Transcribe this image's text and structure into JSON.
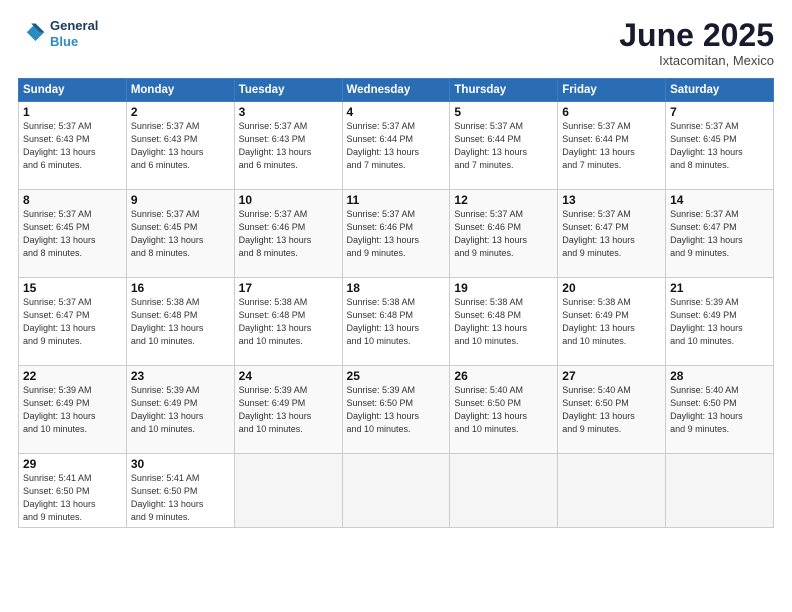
{
  "logo": {
    "line1": "General",
    "line2": "Blue"
  },
  "title": "June 2025",
  "subtitle": "Ixtacomitan, Mexico",
  "weekdays": [
    "Sunday",
    "Monday",
    "Tuesday",
    "Wednesday",
    "Thursday",
    "Friday",
    "Saturday"
  ],
  "weeks": [
    [
      {
        "day": "1",
        "info": "Sunrise: 5:37 AM\nSunset: 6:43 PM\nDaylight: 13 hours\nand 6 minutes."
      },
      {
        "day": "2",
        "info": "Sunrise: 5:37 AM\nSunset: 6:43 PM\nDaylight: 13 hours\nand 6 minutes."
      },
      {
        "day": "3",
        "info": "Sunrise: 5:37 AM\nSunset: 6:43 PM\nDaylight: 13 hours\nand 6 minutes."
      },
      {
        "day": "4",
        "info": "Sunrise: 5:37 AM\nSunset: 6:44 PM\nDaylight: 13 hours\nand 7 minutes."
      },
      {
        "day": "5",
        "info": "Sunrise: 5:37 AM\nSunset: 6:44 PM\nDaylight: 13 hours\nand 7 minutes."
      },
      {
        "day": "6",
        "info": "Sunrise: 5:37 AM\nSunset: 6:44 PM\nDaylight: 13 hours\nand 7 minutes."
      },
      {
        "day": "7",
        "info": "Sunrise: 5:37 AM\nSunset: 6:45 PM\nDaylight: 13 hours\nand 8 minutes."
      }
    ],
    [
      {
        "day": "8",
        "info": "Sunrise: 5:37 AM\nSunset: 6:45 PM\nDaylight: 13 hours\nand 8 minutes."
      },
      {
        "day": "9",
        "info": "Sunrise: 5:37 AM\nSunset: 6:45 PM\nDaylight: 13 hours\nand 8 minutes."
      },
      {
        "day": "10",
        "info": "Sunrise: 5:37 AM\nSunset: 6:46 PM\nDaylight: 13 hours\nand 8 minutes."
      },
      {
        "day": "11",
        "info": "Sunrise: 5:37 AM\nSunset: 6:46 PM\nDaylight: 13 hours\nand 9 minutes."
      },
      {
        "day": "12",
        "info": "Sunrise: 5:37 AM\nSunset: 6:46 PM\nDaylight: 13 hours\nand 9 minutes."
      },
      {
        "day": "13",
        "info": "Sunrise: 5:37 AM\nSunset: 6:47 PM\nDaylight: 13 hours\nand 9 minutes."
      },
      {
        "day": "14",
        "info": "Sunrise: 5:37 AM\nSunset: 6:47 PM\nDaylight: 13 hours\nand 9 minutes."
      }
    ],
    [
      {
        "day": "15",
        "info": "Sunrise: 5:37 AM\nSunset: 6:47 PM\nDaylight: 13 hours\nand 9 minutes."
      },
      {
        "day": "16",
        "info": "Sunrise: 5:38 AM\nSunset: 6:48 PM\nDaylight: 13 hours\nand 10 minutes."
      },
      {
        "day": "17",
        "info": "Sunrise: 5:38 AM\nSunset: 6:48 PM\nDaylight: 13 hours\nand 10 minutes."
      },
      {
        "day": "18",
        "info": "Sunrise: 5:38 AM\nSunset: 6:48 PM\nDaylight: 13 hours\nand 10 minutes."
      },
      {
        "day": "19",
        "info": "Sunrise: 5:38 AM\nSunset: 6:48 PM\nDaylight: 13 hours\nand 10 minutes."
      },
      {
        "day": "20",
        "info": "Sunrise: 5:38 AM\nSunset: 6:49 PM\nDaylight: 13 hours\nand 10 minutes."
      },
      {
        "day": "21",
        "info": "Sunrise: 5:39 AM\nSunset: 6:49 PM\nDaylight: 13 hours\nand 10 minutes."
      }
    ],
    [
      {
        "day": "22",
        "info": "Sunrise: 5:39 AM\nSunset: 6:49 PM\nDaylight: 13 hours\nand 10 minutes."
      },
      {
        "day": "23",
        "info": "Sunrise: 5:39 AM\nSunset: 6:49 PM\nDaylight: 13 hours\nand 10 minutes."
      },
      {
        "day": "24",
        "info": "Sunrise: 5:39 AM\nSunset: 6:49 PM\nDaylight: 13 hours\nand 10 minutes."
      },
      {
        "day": "25",
        "info": "Sunrise: 5:39 AM\nSunset: 6:50 PM\nDaylight: 13 hours\nand 10 minutes."
      },
      {
        "day": "26",
        "info": "Sunrise: 5:40 AM\nSunset: 6:50 PM\nDaylight: 13 hours\nand 10 minutes."
      },
      {
        "day": "27",
        "info": "Sunrise: 5:40 AM\nSunset: 6:50 PM\nDaylight: 13 hours\nand 9 minutes."
      },
      {
        "day": "28",
        "info": "Sunrise: 5:40 AM\nSunset: 6:50 PM\nDaylight: 13 hours\nand 9 minutes."
      }
    ],
    [
      {
        "day": "29",
        "info": "Sunrise: 5:41 AM\nSunset: 6:50 PM\nDaylight: 13 hours\nand 9 minutes."
      },
      {
        "day": "30",
        "info": "Sunrise: 5:41 AM\nSunset: 6:50 PM\nDaylight: 13 hours\nand 9 minutes."
      },
      null,
      null,
      null,
      null,
      null
    ]
  ]
}
